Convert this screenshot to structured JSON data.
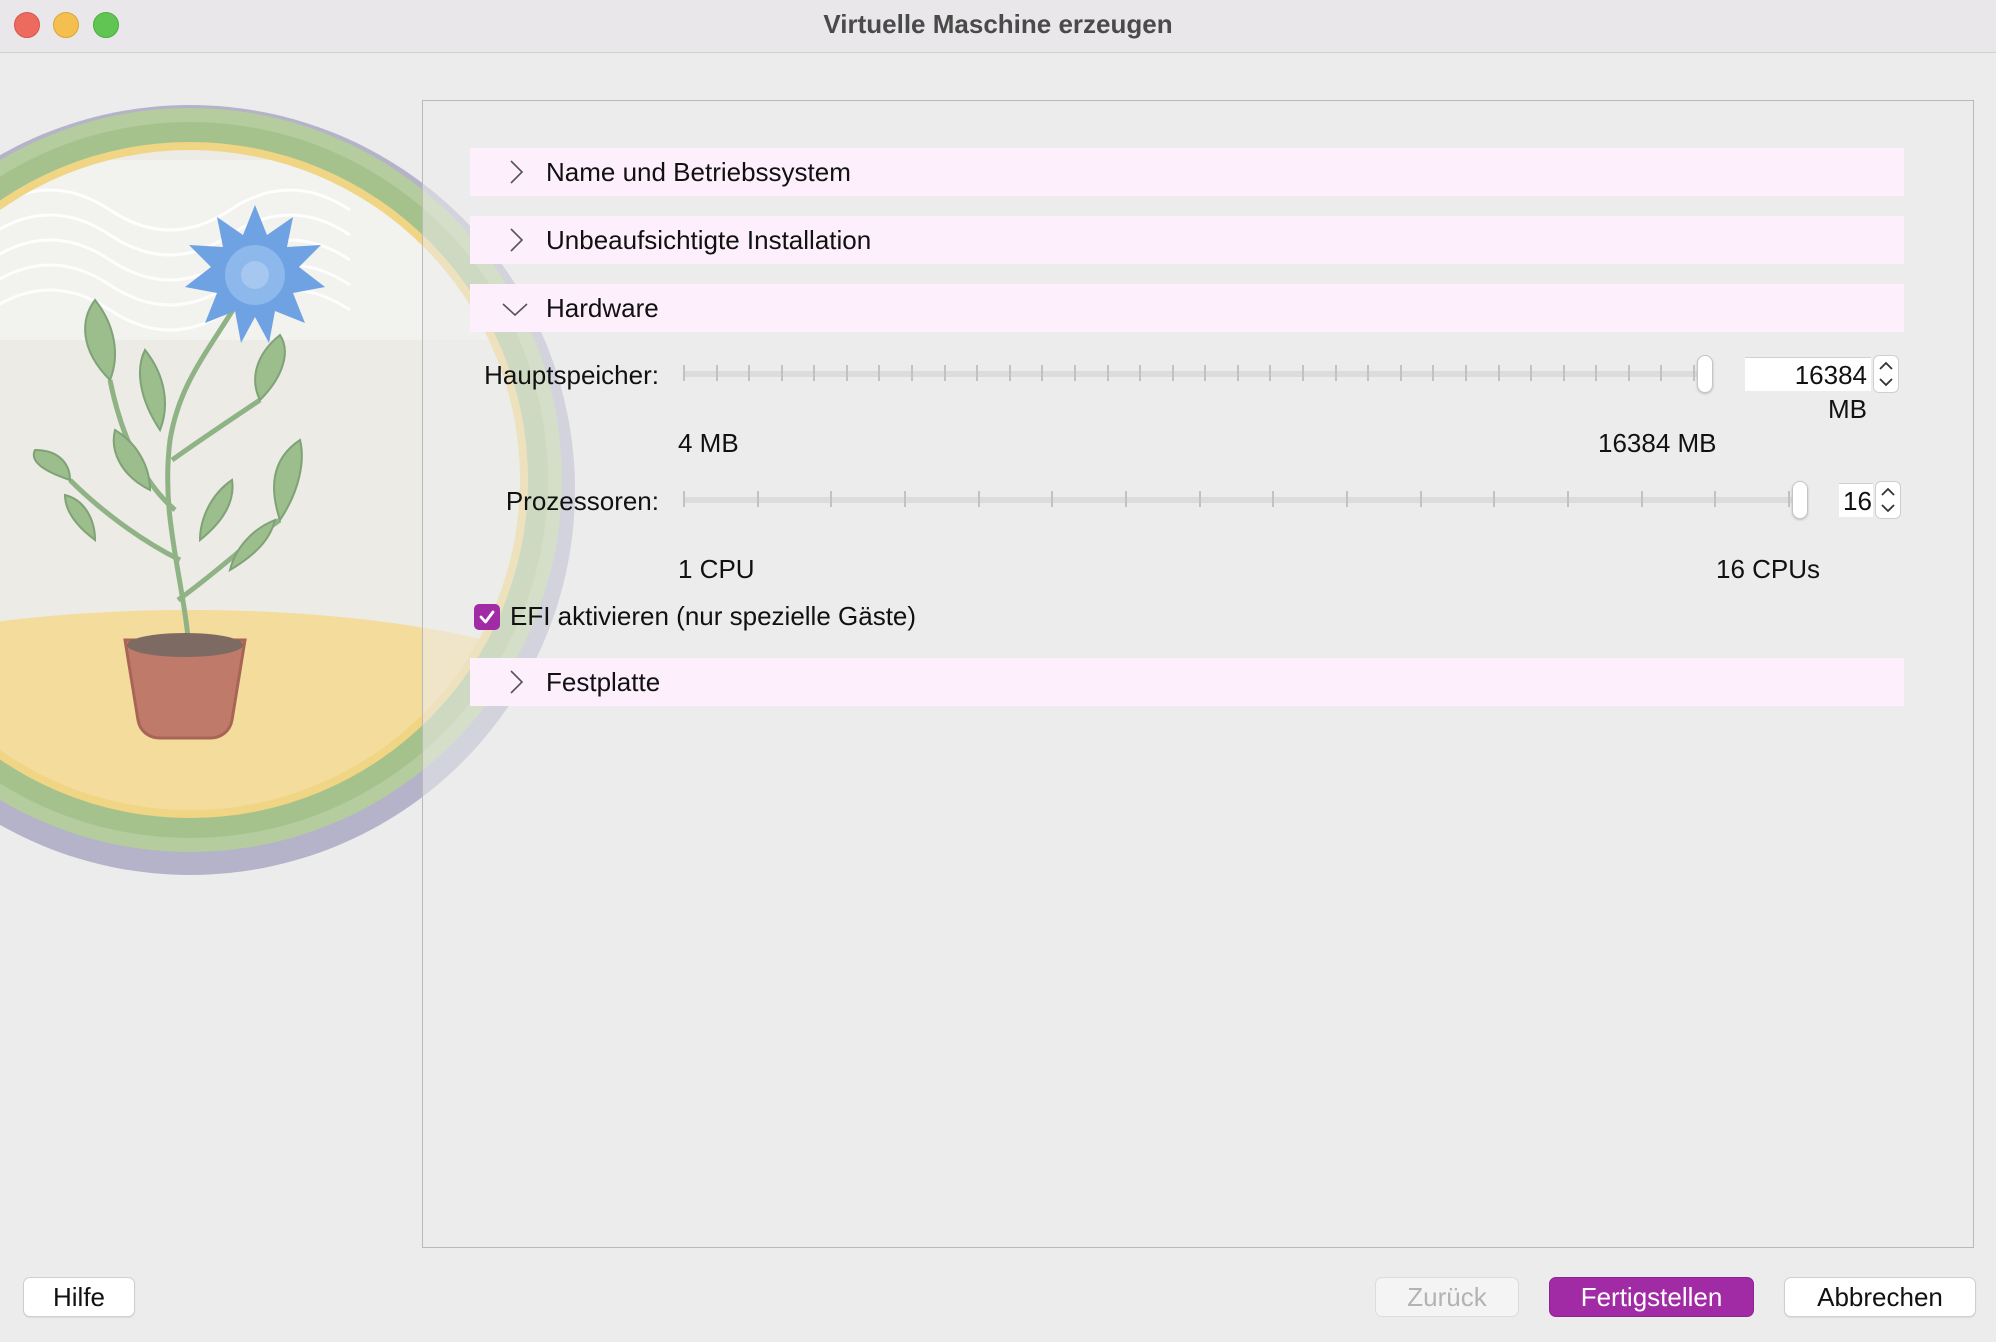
{
  "window": {
    "title": "Virtuelle Maschine erzeugen"
  },
  "sections": {
    "name_os": {
      "label": "Name und Betriebssystem",
      "expanded": false
    },
    "unattended": {
      "label": "Unbeaufsichtigte Installation",
      "expanded": false
    },
    "hardware": {
      "label": "Hardware",
      "expanded": true
    },
    "disk": {
      "label": "Festplatte",
      "expanded": false
    }
  },
  "hardware": {
    "memory": {
      "label": "Hauptspeicher:",
      "value": "16384 MB",
      "min_label": "4 MB",
      "max_label": "16384 MB",
      "fraction": 1.0
    },
    "processors": {
      "label": "Prozessoren:",
      "value": "16",
      "min_label": "1 CPU",
      "max_label": "16 CPUs",
      "fraction": 1.0
    },
    "efi": {
      "label": "EFI aktivieren (nur spezielle Gäste)",
      "checked": true
    }
  },
  "buttons": {
    "help": "Hilfe",
    "back": "Zurück",
    "finish": "Fertigstellen",
    "cancel": "Abbrechen"
  },
  "colors": {
    "accent": "#a12ba5",
    "section_bg": "#fdf0fc"
  }
}
